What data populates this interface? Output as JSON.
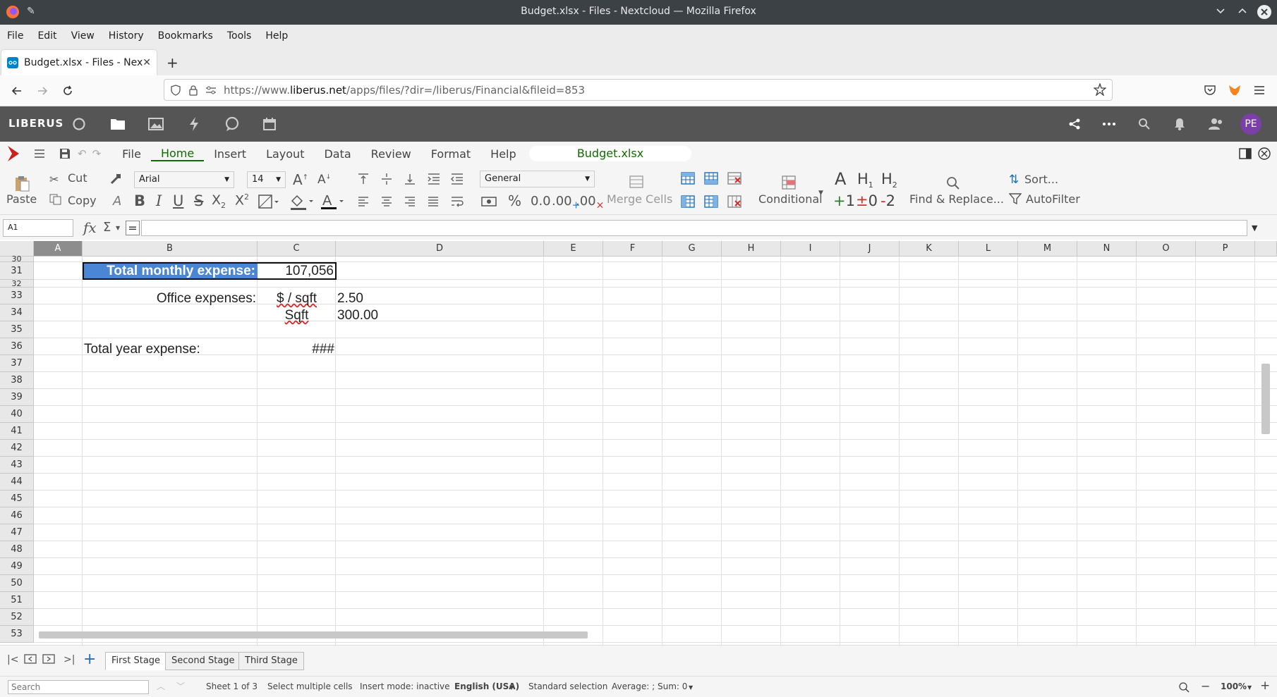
{
  "window": {
    "title": "Budget.xlsx - Files - Nextcloud — Mozilla Firefox"
  },
  "menubar": [
    "File",
    "Edit",
    "View",
    "History",
    "Bookmarks",
    "Tools",
    "Help"
  ],
  "tab": {
    "label": "Budget.xlsx - Files - Nextcl"
  },
  "url": {
    "prefix": "https://www.",
    "domain": "liberus.net",
    "path": "/apps/files/?dir=/liberus/Financial&fileid=853"
  },
  "nextcloud": {
    "logo": "LIBERUS",
    "avatar": "PE"
  },
  "office": {
    "menus": [
      "File",
      "Home",
      "Insert",
      "Layout",
      "Data",
      "Review",
      "Format",
      "Help"
    ],
    "active_menu": "Home",
    "doc_title": "Budget.xlsx"
  },
  "ribbon": {
    "paste": "Paste",
    "cut": "Cut",
    "copy": "Copy",
    "font": "Arial",
    "size": "14",
    "number_format": "General",
    "merge_cells": "Merge Cells",
    "conditional": "Conditional",
    "find_replace": "Find & Replace...",
    "sort": "Sort...",
    "autofilter": "AutoFilter"
  },
  "formula": {
    "cell_ref": "A1",
    "fx": "fx",
    "sigma": "Σ",
    "equals": "="
  },
  "columns": [
    "A",
    "B",
    "C",
    "D",
    "E",
    "F",
    "G",
    "H",
    "I",
    "J",
    "K",
    "L",
    "M",
    "N",
    "O",
    "P"
  ],
  "rows": [
    "30",
    "31",
    "32",
    "33",
    "34",
    "35",
    "36",
    "37",
    "38",
    "39",
    "40",
    "41",
    "42",
    "43",
    "44",
    "45",
    "46",
    "47",
    "48",
    "49",
    "50",
    "51",
    "52",
    "53"
  ],
  "cells": {
    "b31": "Total monthly expense:",
    "c31": "107,056",
    "b33": "Office expenses:",
    "c33": "$ / sqft",
    "d33": "2.50",
    "c34": "Sqft",
    "d34": "300.00",
    "b36": "Total year expense:",
    "c36": "###"
  },
  "sheets": [
    "First Stage",
    "Second Stage",
    "Third Stage"
  ],
  "status": {
    "search_placeholder": "Search",
    "sheet": "Sheet 1 of 3",
    "selection_mode": "Select multiple cells",
    "insert_mode": "Insert mode: inactive",
    "language": "English (USA)",
    "selection": "Standard selection",
    "summary": "Average: ; Sum: 0",
    "zoom": "100%"
  },
  "colors": {
    "accent": "#106b00",
    "highlight": "#4a86d4",
    "header": "#555555"
  }
}
